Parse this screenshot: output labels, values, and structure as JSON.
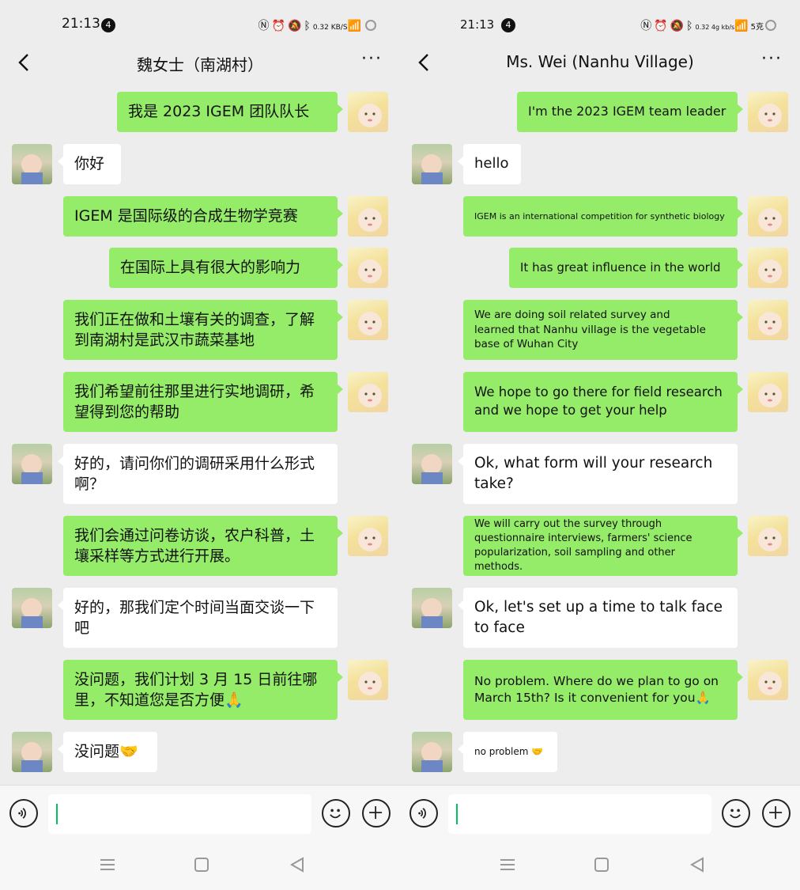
{
  "left": {
    "status": {
      "time": "21:13",
      "notif": "4",
      "net": "0.32 KB/S"
    },
    "header": {
      "title": "魏女士（南湖村）"
    },
    "messages": [
      {
        "text": "我是 2023 IGEM 团队队长"
      },
      {
        "text": "你好"
      },
      {
        "text": "IGEM 是国际级的合成生物学竞赛"
      },
      {
        "text": "在国际上具有很大的影响力"
      },
      {
        "text": "我们正在做和土壤有关的调查，了解到南湖村是武汉市蔬菜基地"
      },
      {
        "text": "我们希望前往那里进行实地调研，希望得到您的帮助"
      },
      {
        "text": "好的，请问你们的调研采用什么形式啊？"
      },
      {
        "text": "我们会通过问卷访谈，农户科普，土壤采样等方式进行开展。"
      },
      {
        "text": "好的，那我们定个时间当面交谈一下吧"
      },
      {
        "text": "没问题，我们计划 3 月 15 日前往哪里，不知道您是否方便🙏"
      },
      {
        "text": "没问题🤝"
      }
    ]
  },
  "right": {
    "status": {
      "time": "21:13",
      "notif": "4",
      "net": "0.32 4g kb/s",
      "carrier": "5克"
    },
    "header": {
      "title": "Ms. Wei (Nanhu Village)"
    },
    "messages": [
      {
        "text": "I'm the 2023 IGEM team leader"
      },
      {
        "text": "hello"
      },
      {
        "text": "IGEM is an international competition for synthetic biology"
      },
      {
        "text": "It has great influence in the world"
      },
      {
        "text": "We are doing soil related survey and learned that Nanhu village is the vegetable base of Wuhan City"
      },
      {
        "text": "We hope to go there for field research and we hope to get your help"
      },
      {
        "text": "Ok, what form will your research take?"
      },
      {
        "text": "We will carry out the survey through questionnaire  interviews, farmers' science popularization, soil sampling and other methods."
      },
      {
        "text": "Ok, let's set up a time to talk face to face"
      },
      {
        "text": "No problem. Where do we plan to go on March 15th? Is it convenient for you🙏"
      },
      {
        "text": "no problem 🤝"
      }
    ]
  },
  "colors": {
    "sent": "#95ec69",
    "received": "#ffffff",
    "background": "#ededed",
    "caret": "#07c160"
  },
  "icons": [
    "back-icon",
    "more-icon",
    "voice-icon",
    "emoji-icon",
    "plus-icon",
    "menu-icon",
    "home-icon",
    "back-triangle-icon"
  ]
}
